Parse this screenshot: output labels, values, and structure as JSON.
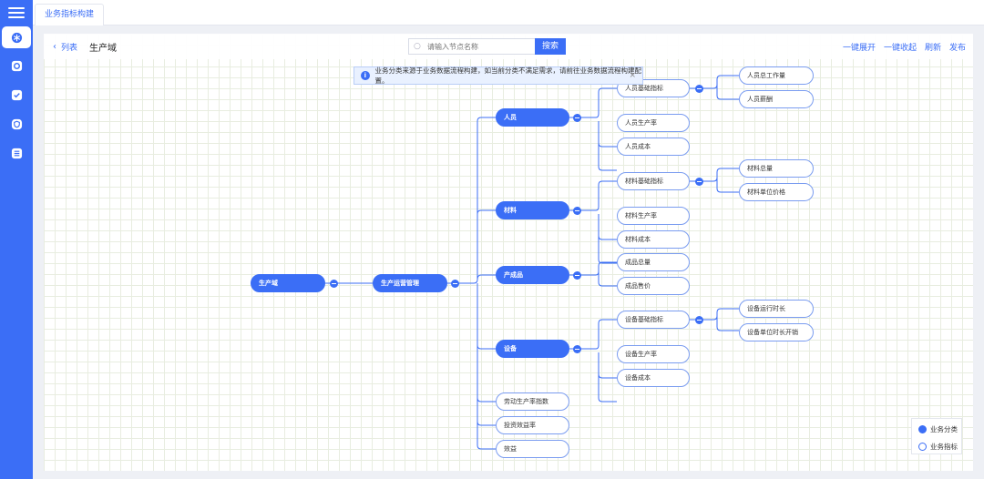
{
  "tabs": [
    "业务指标构建"
  ],
  "header": {
    "back_label": "列表",
    "title": "生产域",
    "search_placeholder": "请输入节点名称",
    "search_button": "搜索",
    "actions": [
      "一键展开",
      "一键收起",
      "刷新",
      "发布"
    ]
  },
  "notice": {
    "text": "业务分类来源于业务数据流程构建，如当前分类不满足需求，请前往业务数据流程构建配置。",
    "close": "×"
  },
  "mindmap": {
    "root": "生产域",
    "level1": "生产运营管理",
    "categories": [
      "人员",
      "材料",
      "产成品",
      "设备"
    ],
    "people": {
      "base": "人员基础指标",
      "base_children": [
        "人员总工作量",
        "人员薪酬"
      ],
      "others": [
        "人员生产率",
        "人员成本"
      ]
    },
    "material": {
      "base": "材料基础指标",
      "base_children": [
        "材料总量",
        "材料单位价格"
      ],
      "others": [
        "材料生产率",
        "材料成本"
      ]
    },
    "product": {
      "items": [
        "成品总量",
        "成品售价"
      ]
    },
    "equipment": {
      "base": "设备基础指标",
      "base_children": [
        "设备运行时长",
        "设备单位时长开销"
      ],
      "others": [
        "设备生产率",
        "设备成本"
      ]
    },
    "direct": [
      "劳动生产率指数",
      "投资效益率",
      "效益"
    ]
  },
  "legend": {
    "category": "业务分类",
    "indicator": "业务指标"
  },
  "colors": {
    "primary": "#3b6ef6",
    "grid": "#e8ede0"
  }
}
